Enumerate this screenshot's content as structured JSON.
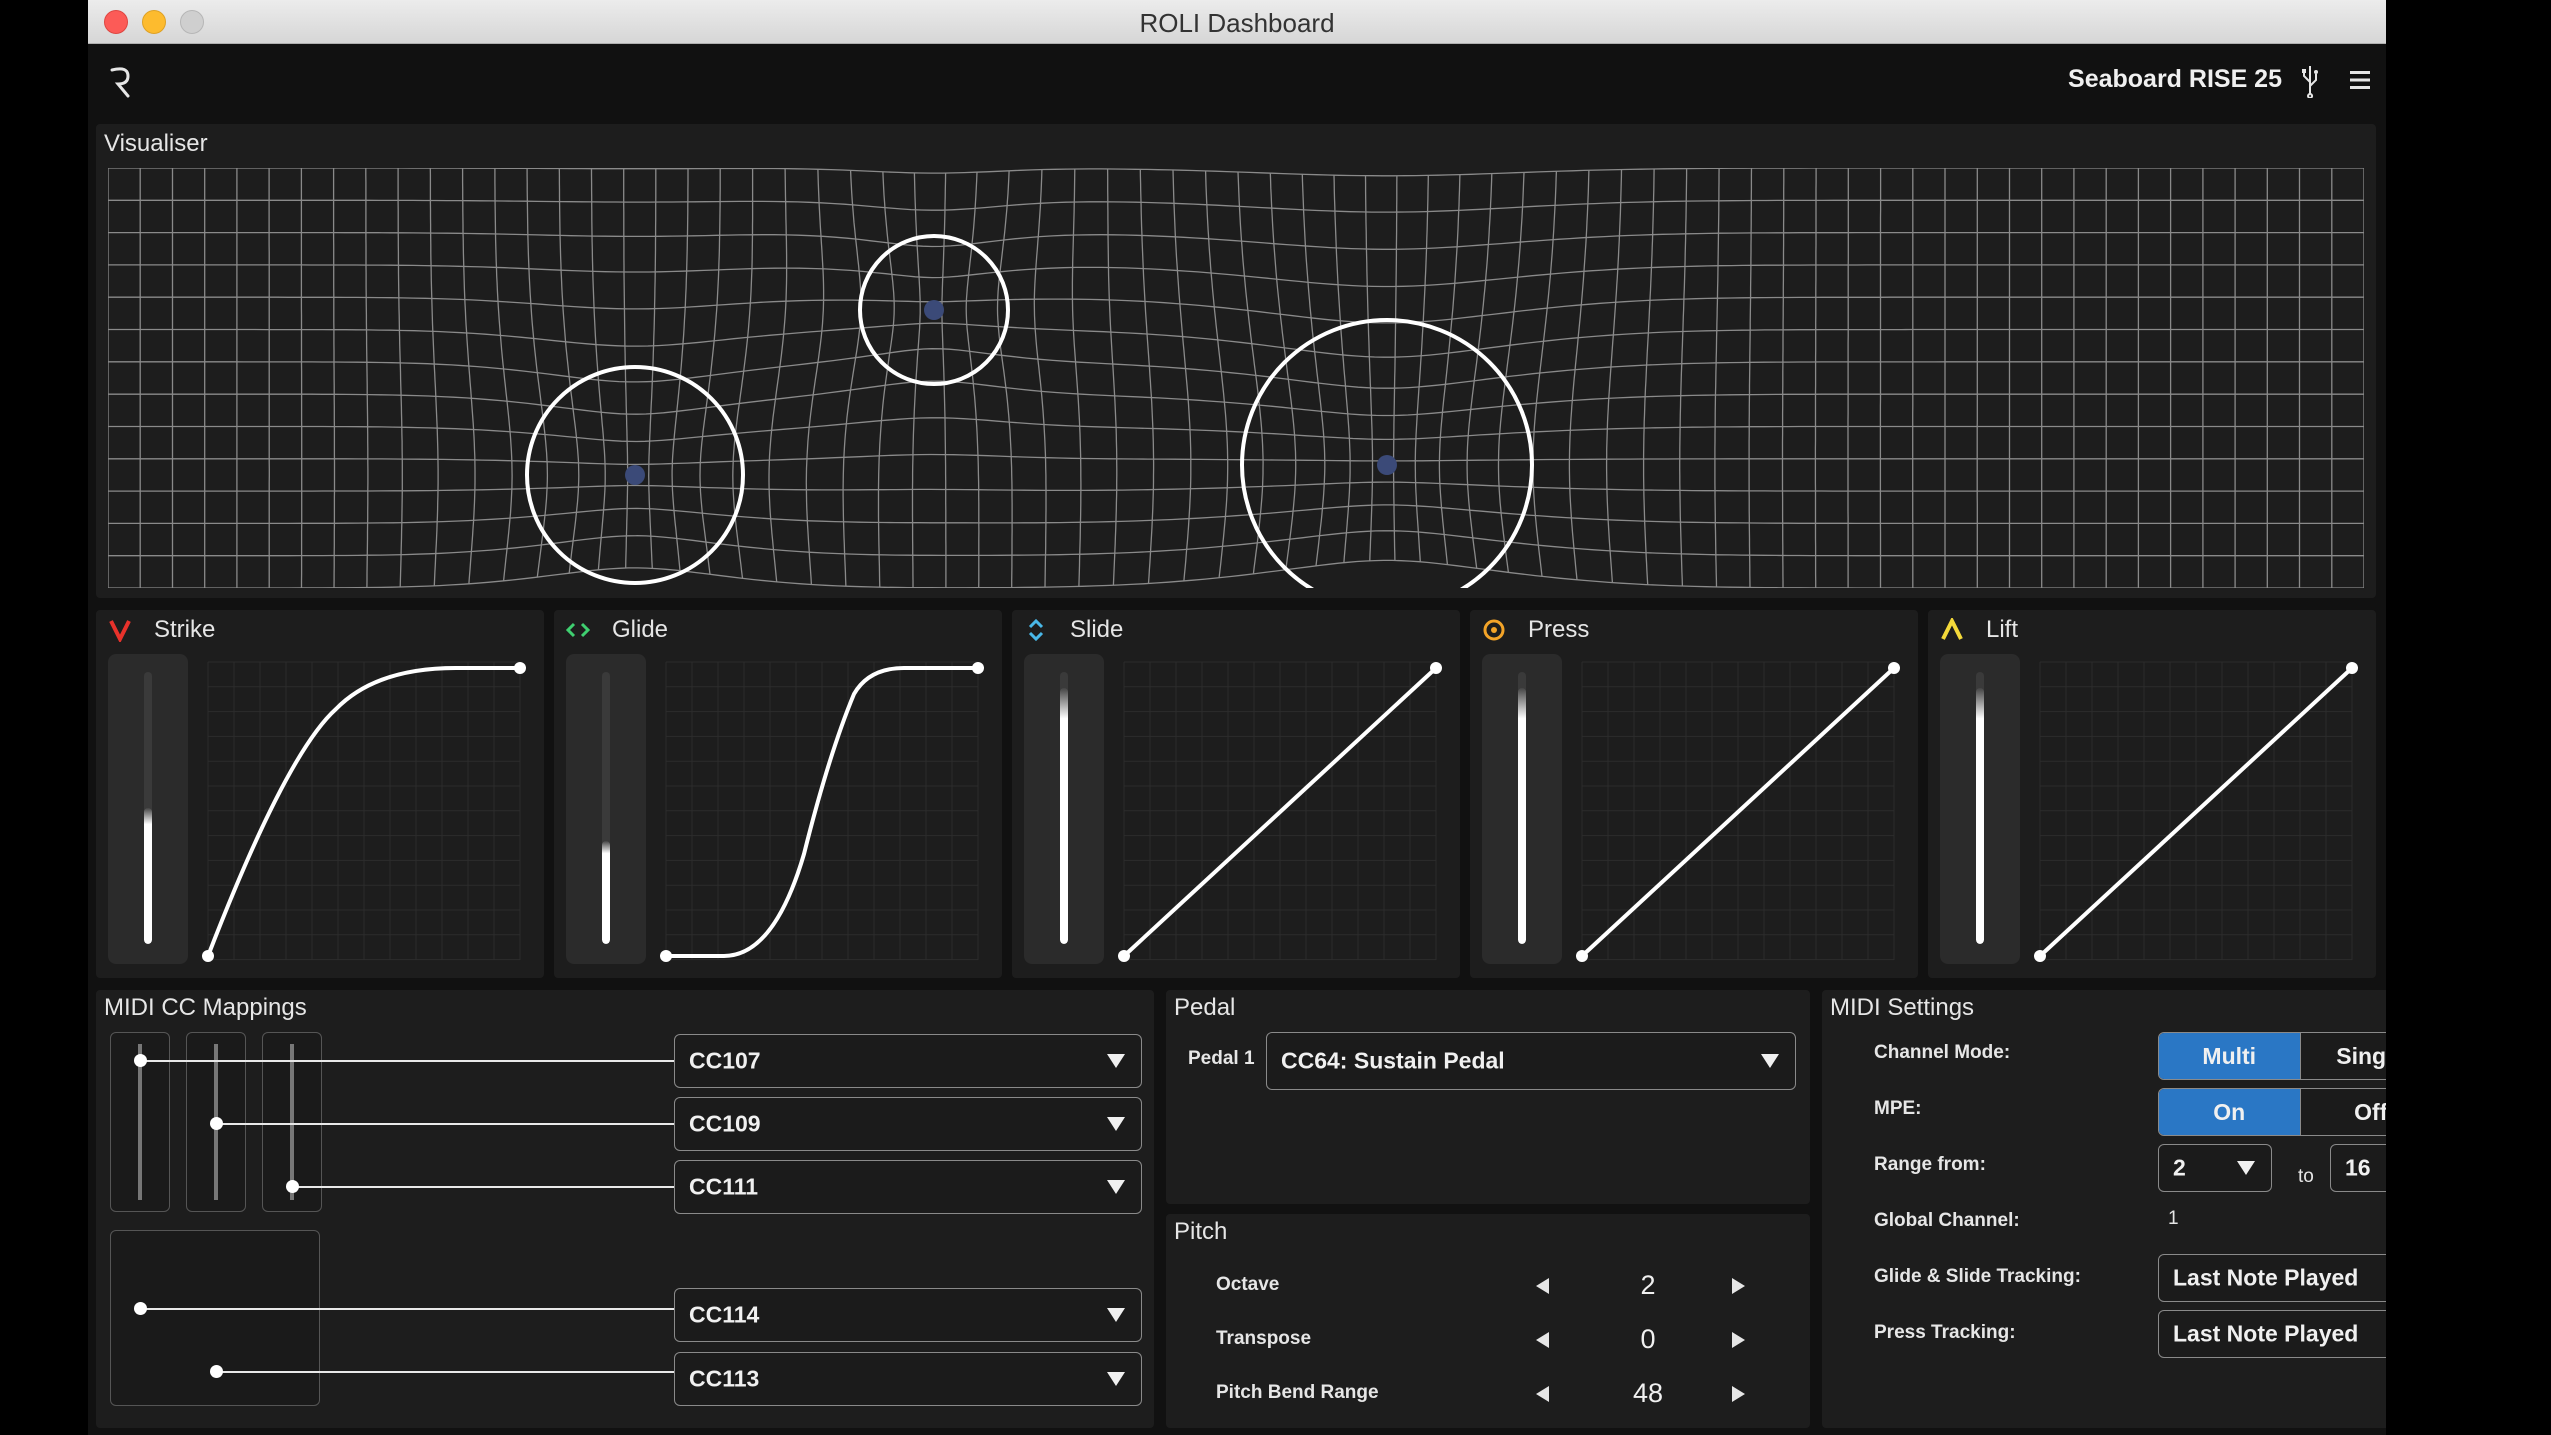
{
  "window": {
    "title": "ROLI Dashboard"
  },
  "header": {
    "device_name": "Seaboard RISE 25",
    "icons": [
      "roli-logo-icon",
      "usb-icon",
      "menu-icon"
    ]
  },
  "visualiser": {
    "title": "Visualiser"
  },
  "expressions": [
    {
      "name": "Strike",
      "icon": "strike-v-icon",
      "color": "#e8322b",
      "level": 0.5
    },
    {
      "name": "Glide",
      "icon": "glide-arrows-icon",
      "color": "#3fcf70",
      "level": 0.38
    },
    {
      "name": "Slide",
      "icon": "slide-arrows-icon",
      "color": "#49b8e8",
      "level": 0.94
    },
    {
      "name": "Press",
      "icon": "press-circle-icon",
      "color": "#f3a428",
      "level": 0.94
    },
    {
      "name": "Lift",
      "icon": "lift-caret-icon",
      "color": "#f4d93a",
      "level": 0.94
    }
  ],
  "midi_cc": {
    "title": "MIDI CC Mappings",
    "mappings": [
      "CC107",
      "CC109",
      "CC111",
      "CC114",
      "CC113"
    ]
  },
  "pedal": {
    "title": "Pedal",
    "label": "Pedal 1",
    "value": "CC64: Sustain Pedal"
  },
  "pitch": {
    "title": "Pitch",
    "rows": [
      {
        "label": "Octave",
        "value": "2"
      },
      {
        "label": "Transpose",
        "value": "0"
      },
      {
        "label": "Pitch Bend Range",
        "value": "48"
      }
    ]
  },
  "midi_settings": {
    "title": "MIDI Settings",
    "channel_mode_label": "Channel Mode:",
    "channel_mode_options": [
      "Multi",
      "Single"
    ],
    "mpe_label": "MPE:",
    "mpe_options": [
      "On",
      "Off"
    ],
    "range_label": "Range from:",
    "range_from": "2",
    "range_to_label": "to",
    "range_to": "16",
    "global_channel_label": "Global Channel:",
    "global_channel": "1",
    "glide_tracking_label": "Glide & Slide Tracking:",
    "glide_tracking": "Last Note Played",
    "press_tracking_label": "Press Tracking:",
    "press_tracking": "Last Note Played"
  }
}
